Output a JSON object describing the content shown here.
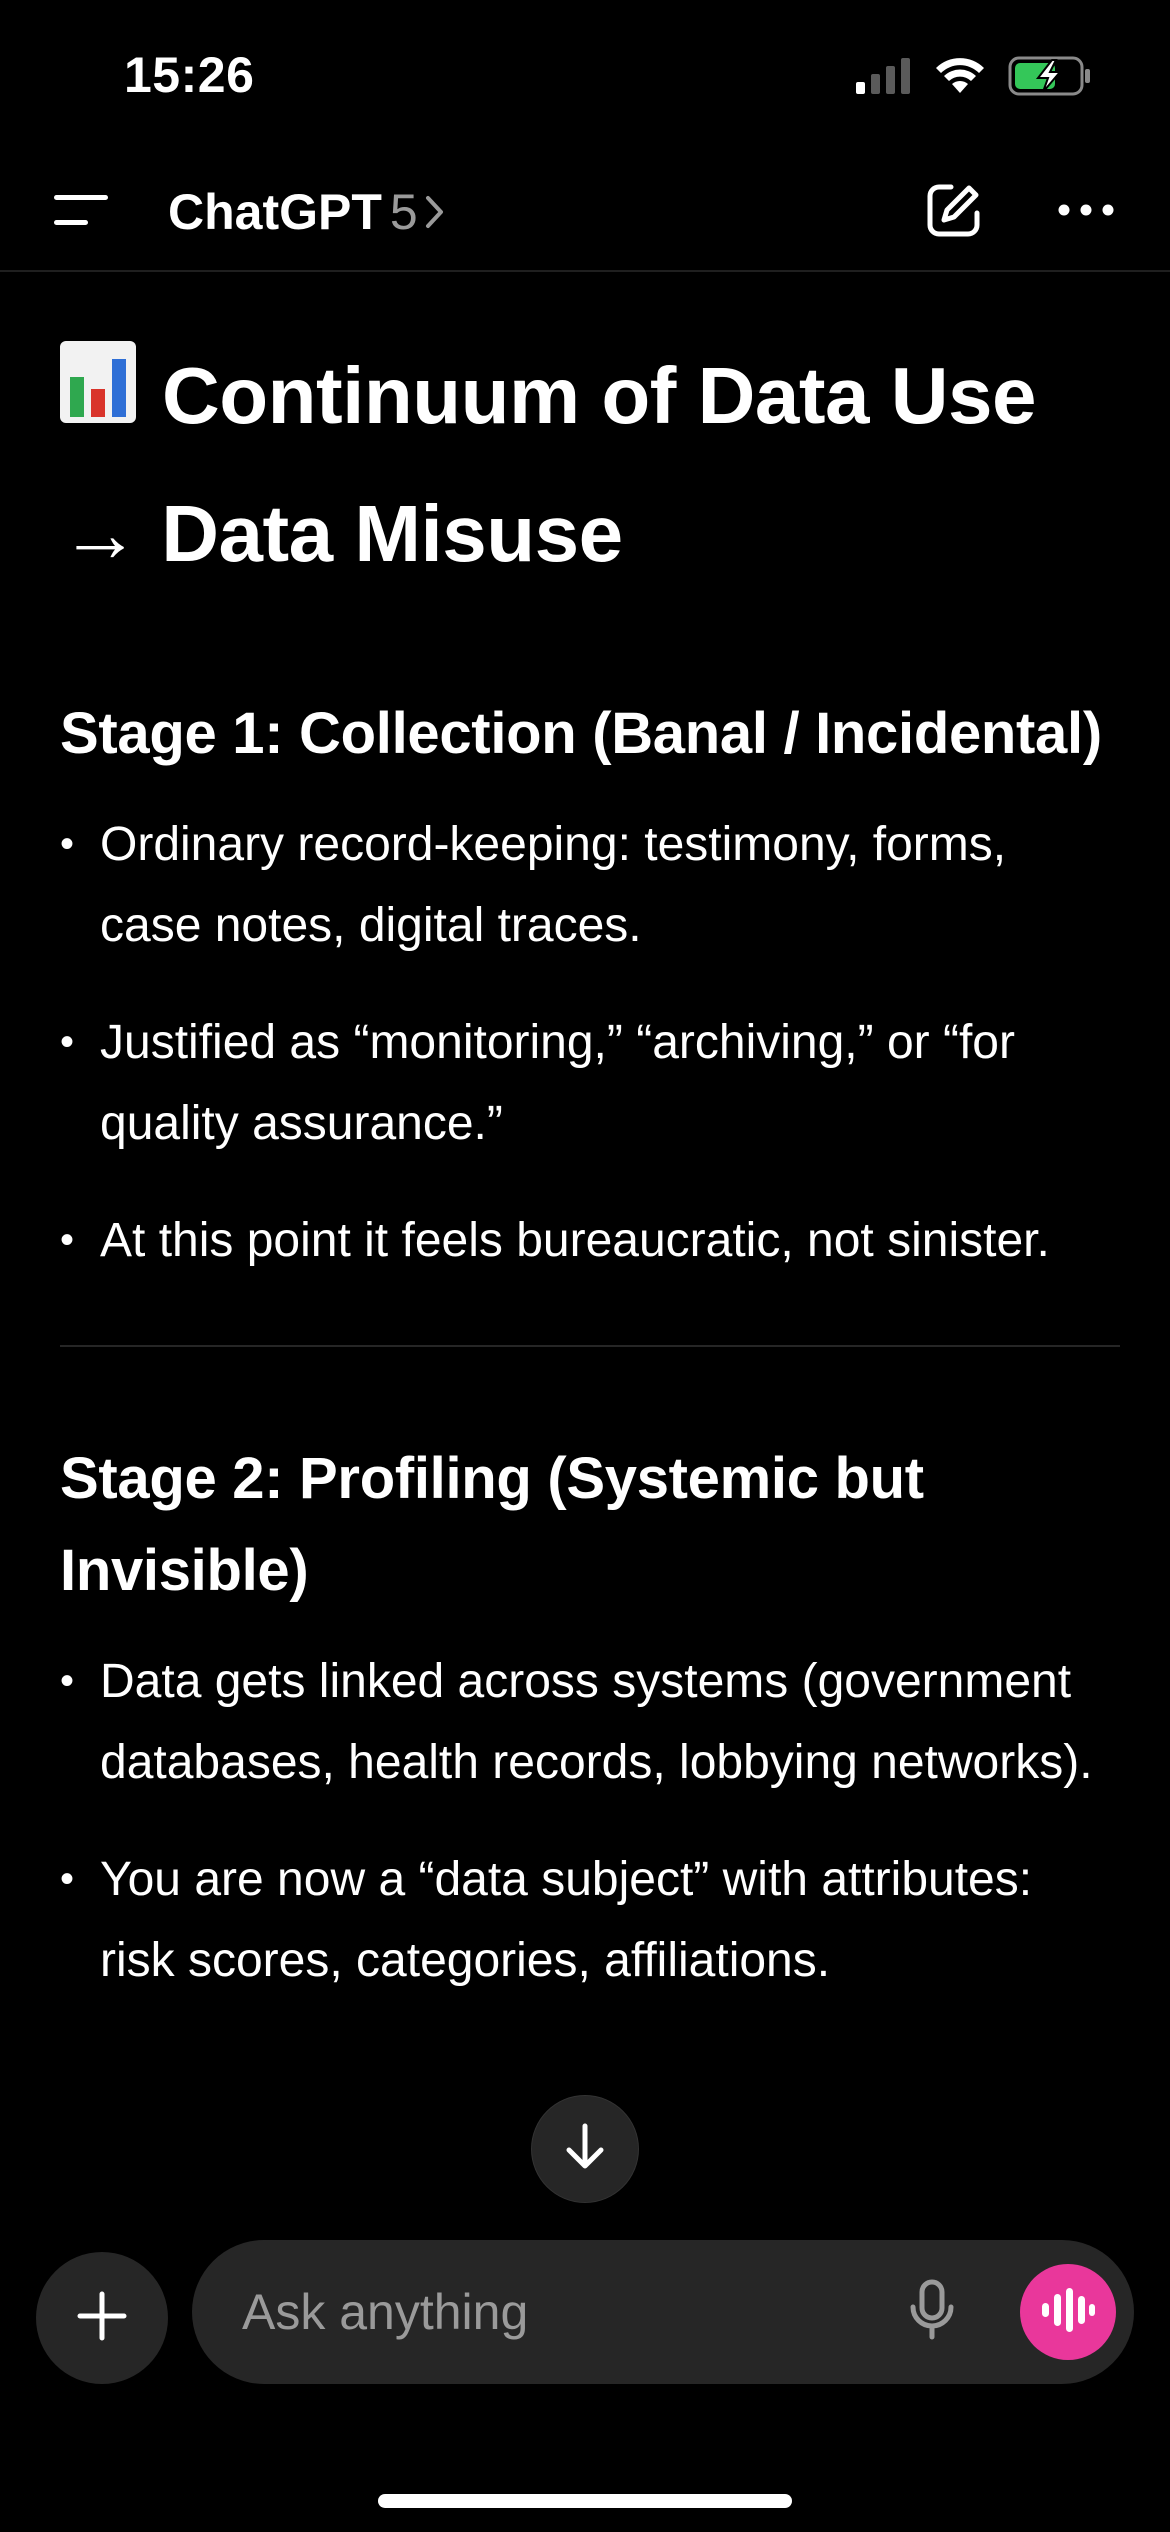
{
  "status_bar": {
    "time": "15:26"
  },
  "header": {
    "title": "ChatGPT",
    "model": "5"
  },
  "content": {
    "heading_line1": "Continuum of Data Use",
    "heading_line2": "→ Data Misuse",
    "heading_icon": "bar-chart-emoji",
    "sections": [
      {
        "title": "Stage 1: Collection (Banal / Incidental)",
        "bullets": [
          "Ordinary record-keeping: testimony, forms, case notes, digital traces.",
          "Justified as “monitoring,” “archiving,” or “for quality assurance.”",
          "At this point it feels bureaucratic, not sinister."
        ]
      },
      {
        "title": "Stage 2: Profiling (Systemic but Invisible)",
        "bullets": [
          "Data gets linked across systems (government databases, health records, lobbying networks).",
          "You are now a “data subject” with attributes: risk scores, categories, affiliations."
        ]
      }
    ]
  },
  "composer": {
    "placeholder": "Ask anything"
  },
  "colors": {
    "background": "#000000",
    "voice_button": "#e9379b",
    "battery": "#34c759"
  }
}
